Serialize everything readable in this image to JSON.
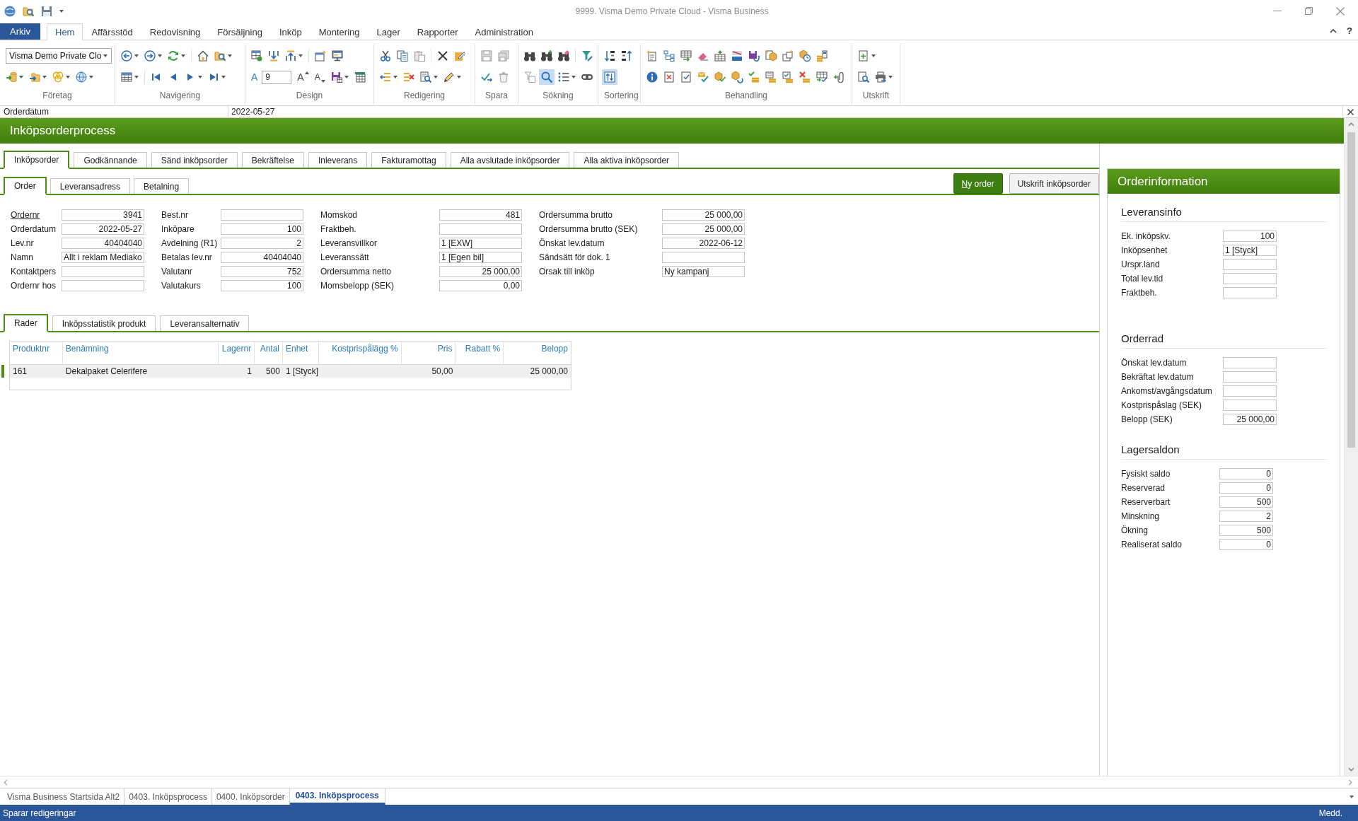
{
  "window": {
    "title": "9999. Visma Demo Private Cloud - Visma Business",
    "help": "?"
  },
  "ribbon": {
    "file_tab": "Arkiv",
    "tabs": [
      {
        "label": "Hem",
        "selected": true
      },
      {
        "label": "Affärsstöd",
        "selected": false
      },
      {
        "label": "Redovisning",
        "selected": false
      },
      {
        "label": "Försäljning",
        "selected": false
      },
      {
        "label": "Inköp",
        "selected": false
      },
      {
        "label": "Montering",
        "selected": false
      },
      {
        "label": "Lager",
        "selected": false
      },
      {
        "label": "Rapporter",
        "selected": false
      },
      {
        "label": "Administration",
        "selected": false
      }
    ],
    "company": "Visma Demo Private Clo",
    "font_color_glyph": "A",
    "font_size": "9",
    "grow_font_glyph": "A",
    "shrink_font_glyph": "A",
    "quick_search_on": true,
    "sort_toggle_on": true,
    "groups": [
      "Företag",
      "Navigering",
      "Design",
      "Redigering",
      "Spara",
      "Sökning",
      "Sortering",
      "Behandling",
      "Utskrift"
    ]
  },
  "field_bar": {
    "label": "Orderdatum",
    "value": "2022-05-27"
  },
  "process": {
    "title": "Inköpsorderprocess",
    "tabs": [
      {
        "label": "Inköpsorder",
        "selected": true
      },
      {
        "label": "Godkännande",
        "selected": false
      },
      {
        "label": "Sänd inköpsorder",
        "selected": false
      },
      {
        "label": "Bekräftelse",
        "selected": false
      },
      {
        "label": "Inleverans",
        "selected": false
      },
      {
        "label": "Fakturamottag",
        "selected": false
      },
      {
        "label": "Alla avslutade inköpsorder",
        "selected": false
      },
      {
        "label": "Alla aktiva inköpsorder",
        "selected": false
      }
    ],
    "subtabs": [
      {
        "label": "Order",
        "selected": true
      },
      {
        "label": "Leveransadress",
        "selected": false
      },
      {
        "label": "Betalning",
        "selected": false
      }
    ],
    "buttons": [
      {
        "kind": "primary",
        "label_parts": [
          {
            "text": "N",
            "underline": true
          },
          {
            "text": "y order",
            "underline": false
          }
        ]
      },
      {
        "kind": "secondary",
        "label_parts": [
          {
            "text": "Utskrift inköpsorder",
            "underline": false
          }
        ]
      }
    ]
  },
  "order_form": {
    "columns": [
      [
        {
          "label": "Ordernr",
          "value": "3941",
          "kind": "number",
          "link": true
        },
        {
          "label": "Orderdatum",
          "value": "2022-05-27",
          "kind": "date",
          "link": false
        },
        {
          "label": "Lev.nr",
          "value": "40404040",
          "kind": "number",
          "link": false
        },
        {
          "label": "Namn",
          "value": "Allt i reklam Mediako",
          "kind": "text",
          "link": false
        },
        {
          "label": "Kontaktpers",
          "link": false
        },
        {
          "label": "Ordernr hos",
          "link": false
        }
      ],
      [
        {
          "label": "Best.nr",
          "link": false
        },
        {
          "label": "Inköpare",
          "value": "100",
          "kind": "number",
          "link": false
        },
        {
          "label": "Avdelning (R1)",
          "value": "2",
          "kind": "number",
          "link": false
        },
        {
          "label": "Betalas lev.nr",
          "value": "40404040",
          "kind": "number",
          "link": false
        },
        {
          "label": "Valutanr",
          "value": "752",
          "kind": "number",
          "link": false
        },
        {
          "label": "Valutakurs",
          "value": "100",
          "kind": "number",
          "link": false
        }
      ],
      [
        {
          "label": "Momskod",
          "value": "481",
          "kind": "number",
          "link": false
        },
        {
          "label": "Fraktbeh.",
          "link": false
        },
        {
          "label": "Leveransvillkor",
          "value": "1 [EXW]",
          "kind": "text",
          "link": false
        },
        {
          "label": "Leveranssätt",
          "value": "1 [Egen bil]",
          "kind": "text",
          "link": false
        },
        {
          "label": "Ordersumma netto",
          "value": "25 000,00",
          "kind": "number",
          "link": false
        },
        {
          "label": "Momsbelopp (SEK)",
          "value": "0,00",
          "kind": "number",
          "link": false
        }
      ],
      [
        {
          "label": "Ordersumma brutto",
          "value": "25 000,00",
          "kind": "number",
          "link": false
        },
        {
          "label": "Ordersumma brutto (SEK)",
          "value": "25 000,00",
          "kind": "number",
          "link": false
        },
        {
          "label": "Önskat lev.datum",
          "value": "2022-06-12",
          "kind": "date",
          "link": false
        },
        {
          "label": "Sändsätt för dok. 1",
          "link": false
        },
        {
          "label": "Orsak till inköp",
          "value": "Ny kampanj",
          "kind": "text",
          "link": false
        }
      ]
    ]
  },
  "lines": {
    "tabs": [
      {
        "label": "Rader",
        "selected": true
      },
      {
        "label": "Inköpsstatistik produkt",
        "selected": false
      },
      {
        "label": "Leveransalternativ",
        "selected": false
      }
    ],
    "table": {
      "columns": [
        {
          "label": "Produktnr",
          "kind": "text"
        },
        {
          "label": "Benämning",
          "kind": "text"
        },
        {
          "label": "Lagernr",
          "kind": "number"
        },
        {
          "label": "Antal",
          "kind": "number"
        },
        {
          "label": "Enhet",
          "kind": "text"
        },
        {
          "label": "Kostprispålägg %",
          "kind": "number"
        },
        {
          "label": "Pris",
          "kind": "number"
        },
        {
          "label": "Rabatt %",
          "kind": "number"
        },
        {
          "label": "Belopp",
          "kind": "number"
        }
      ],
      "rows": [
        {
          "selected": true,
          "cells": [
            "161",
            "Dekalpaket Celerifere",
            "1",
            "500",
            "1 [Styck]",
            null,
            "50,00",
            null,
            "25 000,00"
          ]
        }
      ]
    }
  },
  "order_info": {
    "title": "Orderinformation",
    "sections": [
      {
        "title": "Leveransinfo",
        "fields": [
          {
            "label": "Ek. inköpskv.",
            "value": "100",
            "kind": "number"
          },
          {
            "label": "Inköpsenhet",
            "value": "1 [Styck]",
            "kind": "text"
          },
          {
            "label": "Urspr.land"
          },
          {
            "label": "Total lev.tid"
          },
          {
            "label": "Fraktbeh."
          }
        ]
      },
      {
        "title": "Orderrad",
        "fields": [
          {
            "label": "Önskat lev.datum"
          },
          {
            "label": "Bekräftat lev.datum"
          },
          {
            "label": "Ankomst/avgångsdatum"
          },
          {
            "label": "Kostprispåslag (SEK)"
          },
          {
            "label": "Belopp (SEK)",
            "value": "25 000,00",
            "kind": "number"
          }
        ]
      },
      {
        "title": "Lagersaldon",
        "fields": [
          {
            "label": "Fysiskt saldo",
            "value": "0",
            "kind": "number"
          },
          {
            "label": "Reserverad",
            "value": "0",
            "kind": "number"
          },
          {
            "label": "Reserverbart",
            "value": "500",
            "kind": "number"
          },
          {
            "label": "Minskning",
            "value": "2",
            "kind": "number"
          },
          {
            "label": "Ökning",
            "value": "500",
            "kind": "number"
          },
          {
            "label": "Realiserat saldo",
            "value": "0",
            "kind": "number"
          }
        ]
      }
    ]
  },
  "document_tabs": [
    {
      "label": "Visma Business Startsida Alt2",
      "selected": false
    },
    {
      "label": "0403. Inköpsprocess",
      "selected": false
    },
    {
      "label": "0400. Inköpsorder",
      "selected": false
    },
    {
      "label": "0403. Inköpsprocess",
      "selected": true
    }
  ],
  "status_bar": {
    "message": "Sparar redigeringar",
    "messages_label": "Medd."
  }
}
